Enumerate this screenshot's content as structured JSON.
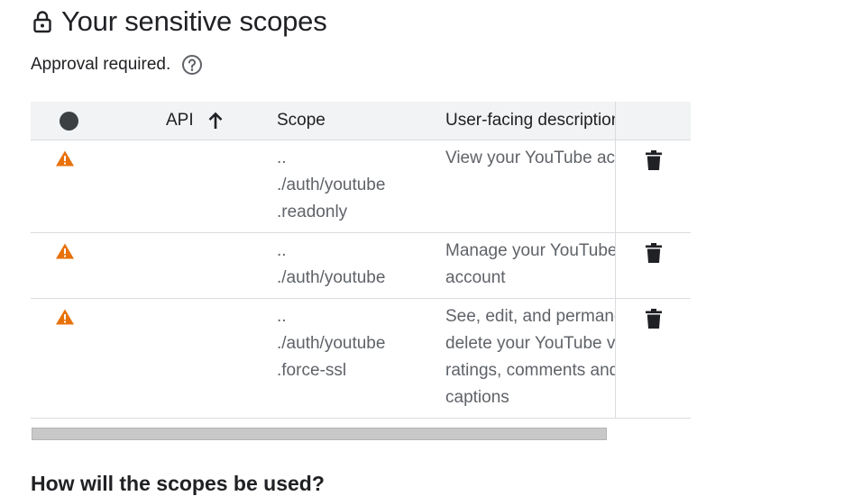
{
  "header": {
    "title": "Your sensitive scopes",
    "subtitle": "Approval required.",
    "lock_icon": "lock-icon",
    "help_icon": "help-circle-icon"
  },
  "table": {
    "columns": {
      "status": "",
      "api": "API",
      "scope": "Scope",
      "description": "User-facing description"
    },
    "sort": {
      "column": "API",
      "direction": "ascending",
      "icon": "arrow-up-icon"
    },
    "rows": [
      {
        "status_icon": "warning-icon",
        "api": "",
        "scope": [
          "..",
          "./auth/youtube",
          ".readonly"
        ],
        "description": [
          "View your YouTube account"
        ],
        "action_icon": "trash-icon"
      },
      {
        "status_icon": "warning-icon",
        "api": "",
        "scope": [
          "..",
          "./auth/youtube"
        ],
        "description": [
          "Manage your YouTube",
          "account"
        ],
        "action_icon": "trash-icon"
      },
      {
        "status_icon": "warning-icon",
        "api": "",
        "scope": [
          "..",
          "./auth/youtube",
          ".force-ssl"
        ],
        "description": [
          "See, edit, and permanently",
          "delete your YouTube videos,",
          "ratings, comments and",
          "captions"
        ],
        "action_icon": "trash-icon"
      }
    ]
  },
  "footer": {
    "heading": "How will the scopes be used?"
  },
  "colors": {
    "warning": "#e8710a",
    "header_bg": "#f1f3f4",
    "divider": "#dadce0",
    "text_primary": "#202124",
    "text_secondary": "#5f6368"
  }
}
